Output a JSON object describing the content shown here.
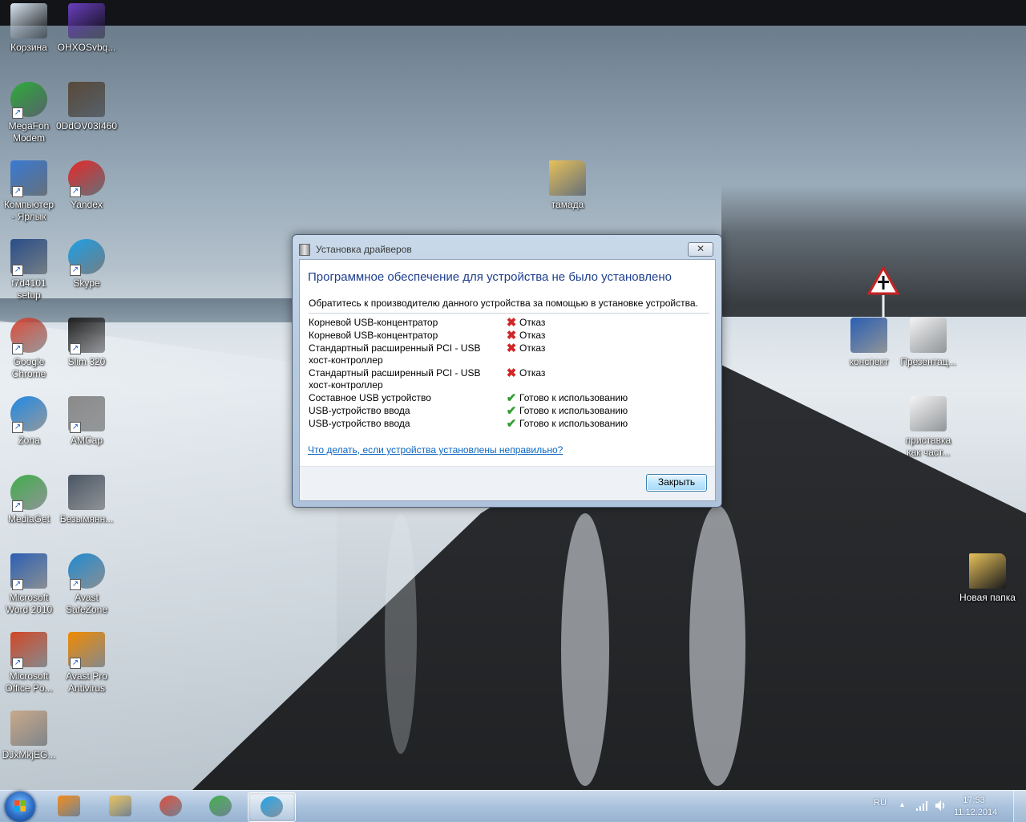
{
  "desktop": {
    "icons": [
      {
        "label": "Корзина",
        "icon": "recycle-bin-icon",
        "color": "#d9e6f2"
      },
      {
        "label": "OHXOSvbq...",
        "icon": "image-file-icon",
        "color": "#6a3fbf"
      },
      {
        "label": "MegaFon\nModem",
        "icon": "megafon-modem-icon",
        "color": "#2fae3a"
      },
      {
        "label": "0DdOV03I460",
        "icon": "image-file-icon",
        "color": "#5a4a3a"
      },
      {
        "label": "Компьютер\n- Ярлык",
        "icon": "computer-icon",
        "color": "#3a7bd5"
      },
      {
        "label": "Yandex",
        "icon": "yandex-browser-icon",
        "color": "#e82a2a"
      },
      {
        "label": "f7d4101\nsetup",
        "icon": "setup-icon",
        "color": "#2a4e8a"
      },
      {
        "label": "Skype",
        "icon": "skype-icon",
        "color": "#1da1e6"
      },
      {
        "label": "Google\nChrome",
        "icon": "chrome-icon",
        "color": "#dd4b39"
      },
      {
        "label": "Slim 320",
        "icon": "webcam-icon",
        "color": "#222222"
      },
      {
        "label": "Zona",
        "icon": "zona-icon",
        "color": "#1e88e5"
      },
      {
        "label": "AMCap",
        "icon": "amcap-icon",
        "color": "#8a8a8a"
      },
      {
        "label": "MediaGet",
        "icon": "mediaget-icon",
        "color": "#3fae49"
      },
      {
        "label": "Безымянн...",
        "icon": "image-file-icon",
        "color": "#4a5563"
      },
      {
        "label": "Microsoft\nWord 2010",
        "icon": "word-icon",
        "color": "#2b5fb4"
      },
      {
        "label": "Avast\nSafeZone",
        "icon": "avast-safezone-icon",
        "color": "#1f8ad1"
      },
      {
        "label": "Microsoft\nOffice Po...",
        "icon": "powerpoint-icon",
        "color": "#d24726"
      },
      {
        "label": "Avast Pro\nAntivirus",
        "icon": "avast-icon",
        "color": "#f08a00"
      },
      {
        "label": "DJxMkjEG...",
        "icon": "image-file-icon",
        "color": "#c9a98a"
      },
      {
        "label": "тамада",
        "icon": "folder-icon",
        "color": "#e8c15a"
      },
      {
        "label": "конспект",
        "icon": "word-document-icon",
        "color": "#2b5fb4"
      },
      {
        "label": "Презентац...",
        "icon": "presentation-icon",
        "color": "#f4f4f4"
      },
      {
        "label": "приставка\nкак част...",
        "icon": "presentation-icon",
        "color": "#f4f4f4"
      },
      {
        "label": "Новая папка",
        "icon": "folder-icon",
        "color": "#e8c15a"
      }
    ]
  },
  "dialog": {
    "title": "Установка драйверов",
    "close_glyph": "✕",
    "heading": "Программное обеспечение для устройства не было установлено",
    "instruction": "Обратитесь к производителю данного устройства за помощью в установке устройства.",
    "devices": [
      {
        "name": "Корневой USB-концентратор",
        "status": "Отказ",
        "state": "fail"
      },
      {
        "name": "Корневой USB-концентратор",
        "status": "Отказ",
        "state": "fail"
      },
      {
        "name": "Стандартный расширенный PCI - USB хост-контроллер",
        "status": "Отказ",
        "state": "fail"
      },
      {
        "name": "Стандартный расширенный PCI - USB хост-контроллер",
        "status": "Отказ",
        "state": "fail"
      },
      {
        "name": "Составное USB устройство",
        "status": "Готово к использованию",
        "state": "ok"
      },
      {
        "name": "USB-устройство ввода",
        "status": "Готово к использованию",
        "state": "ok"
      },
      {
        "name": "USB-устройство ввода",
        "status": "Готово к использованию",
        "state": "ok"
      }
    ],
    "fail_glyph": "✖",
    "ok_glyph": "✔",
    "help_link": "Что делать, если устройства установлены неправильно?",
    "close_button": "Закрыть"
  },
  "taskbar": {
    "pinned": [
      {
        "name": "media-player-icon",
        "color": "#f08a1a"
      },
      {
        "name": "explorer-icon",
        "color": "#e8c15a"
      },
      {
        "name": "chrome-icon",
        "color": "#dd4b39"
      },
      {
        "name": "mediaget-icon",
        "color": "#3fae49"
      },
      {
        "name": "skype-icon",
        "color": "#1da1e6"
      }
    ],
    "language": "RU",
    "tray_arrow": "▲",
    "time": "17:53",
    "date": "11.12.2014"
  }
}
